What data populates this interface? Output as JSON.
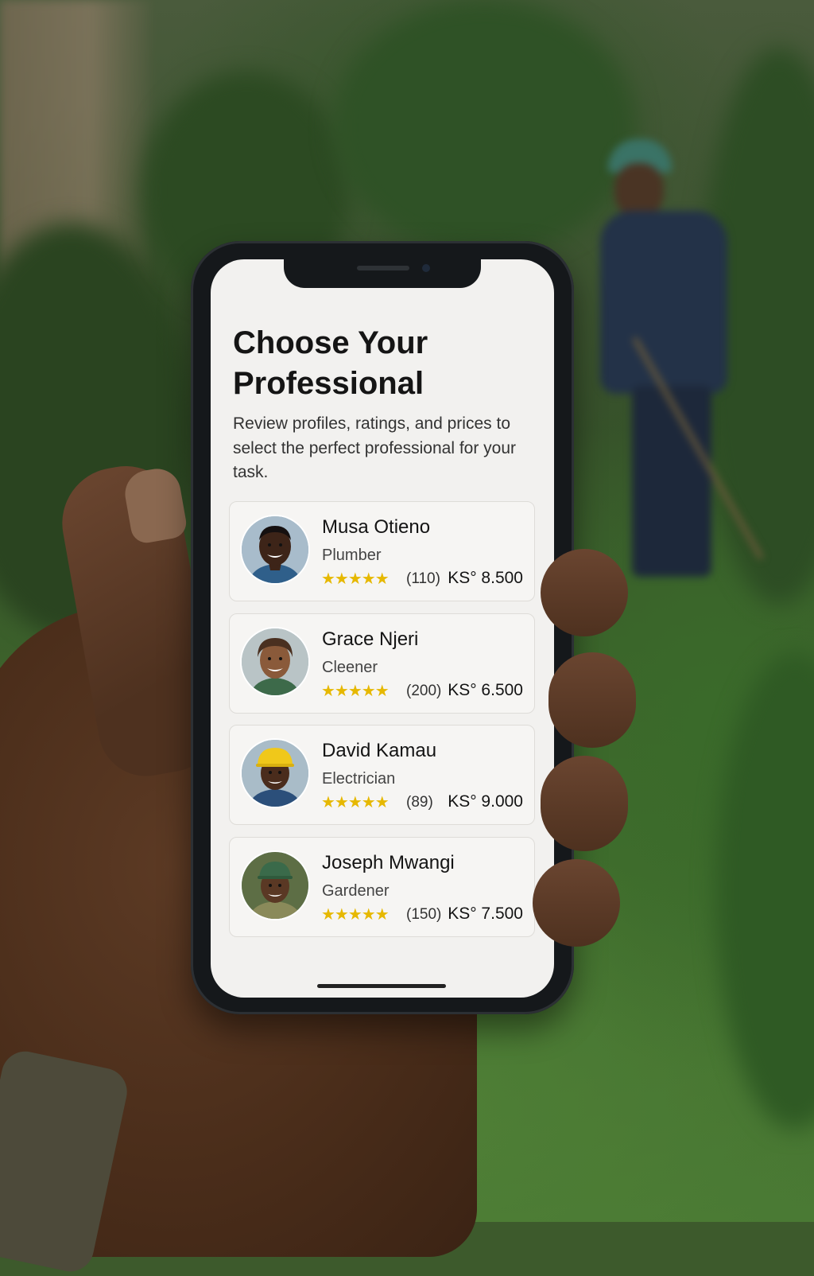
{
  "screen": {
    "title": "Choose Your Professional",
    "subtitle": "Review profiles, ratings, and prices to select the perfect professional for your task."
  },
  "professionals": [
    {
      "name": "Musa Otieno",
      "role": "Plumber",
      "rating": 4.5,
      "stars_text": "★★★★★",
      "reviews": "(110)",
      "price": "KS° 8.500",
      "avatar": "avatar-musa"
    },
    {
      "name": "Grace Njeri",
      "role": "Cleener",
      "rating": 4.5,
      "stars_text": "★★★★★",
      "reviews": "(200)",
      "price": "KS° 6.500",
      "avatar": "avatar-grace"
    },
    {
      "name": "David Kamau",
      "role": "Electrician",
      "rating": 4.5,
      "stars_text": "★★★★★",
      "reviews": "(89)",
      "price": "KS° 9.000",
      "avatar": "avatar-david"
    },
    {
      "name": "Joseph Mwangi",
      "role": "Gardener",
      "rating": 4.5,
      "stars_text": "★★★★★",
      "reviews": "(150)",
      "price": "KS° 7.500",
      "avatar": "avatar-joseph"
    }
  ],
  "colors": {
    "screen_background": "#f2f1ef",
    "card_background": "#f6f5f3",
    "star": "#e6b800",
    "text_primary": "#141414",
    "text_secondary": "#444444"
  }
}
